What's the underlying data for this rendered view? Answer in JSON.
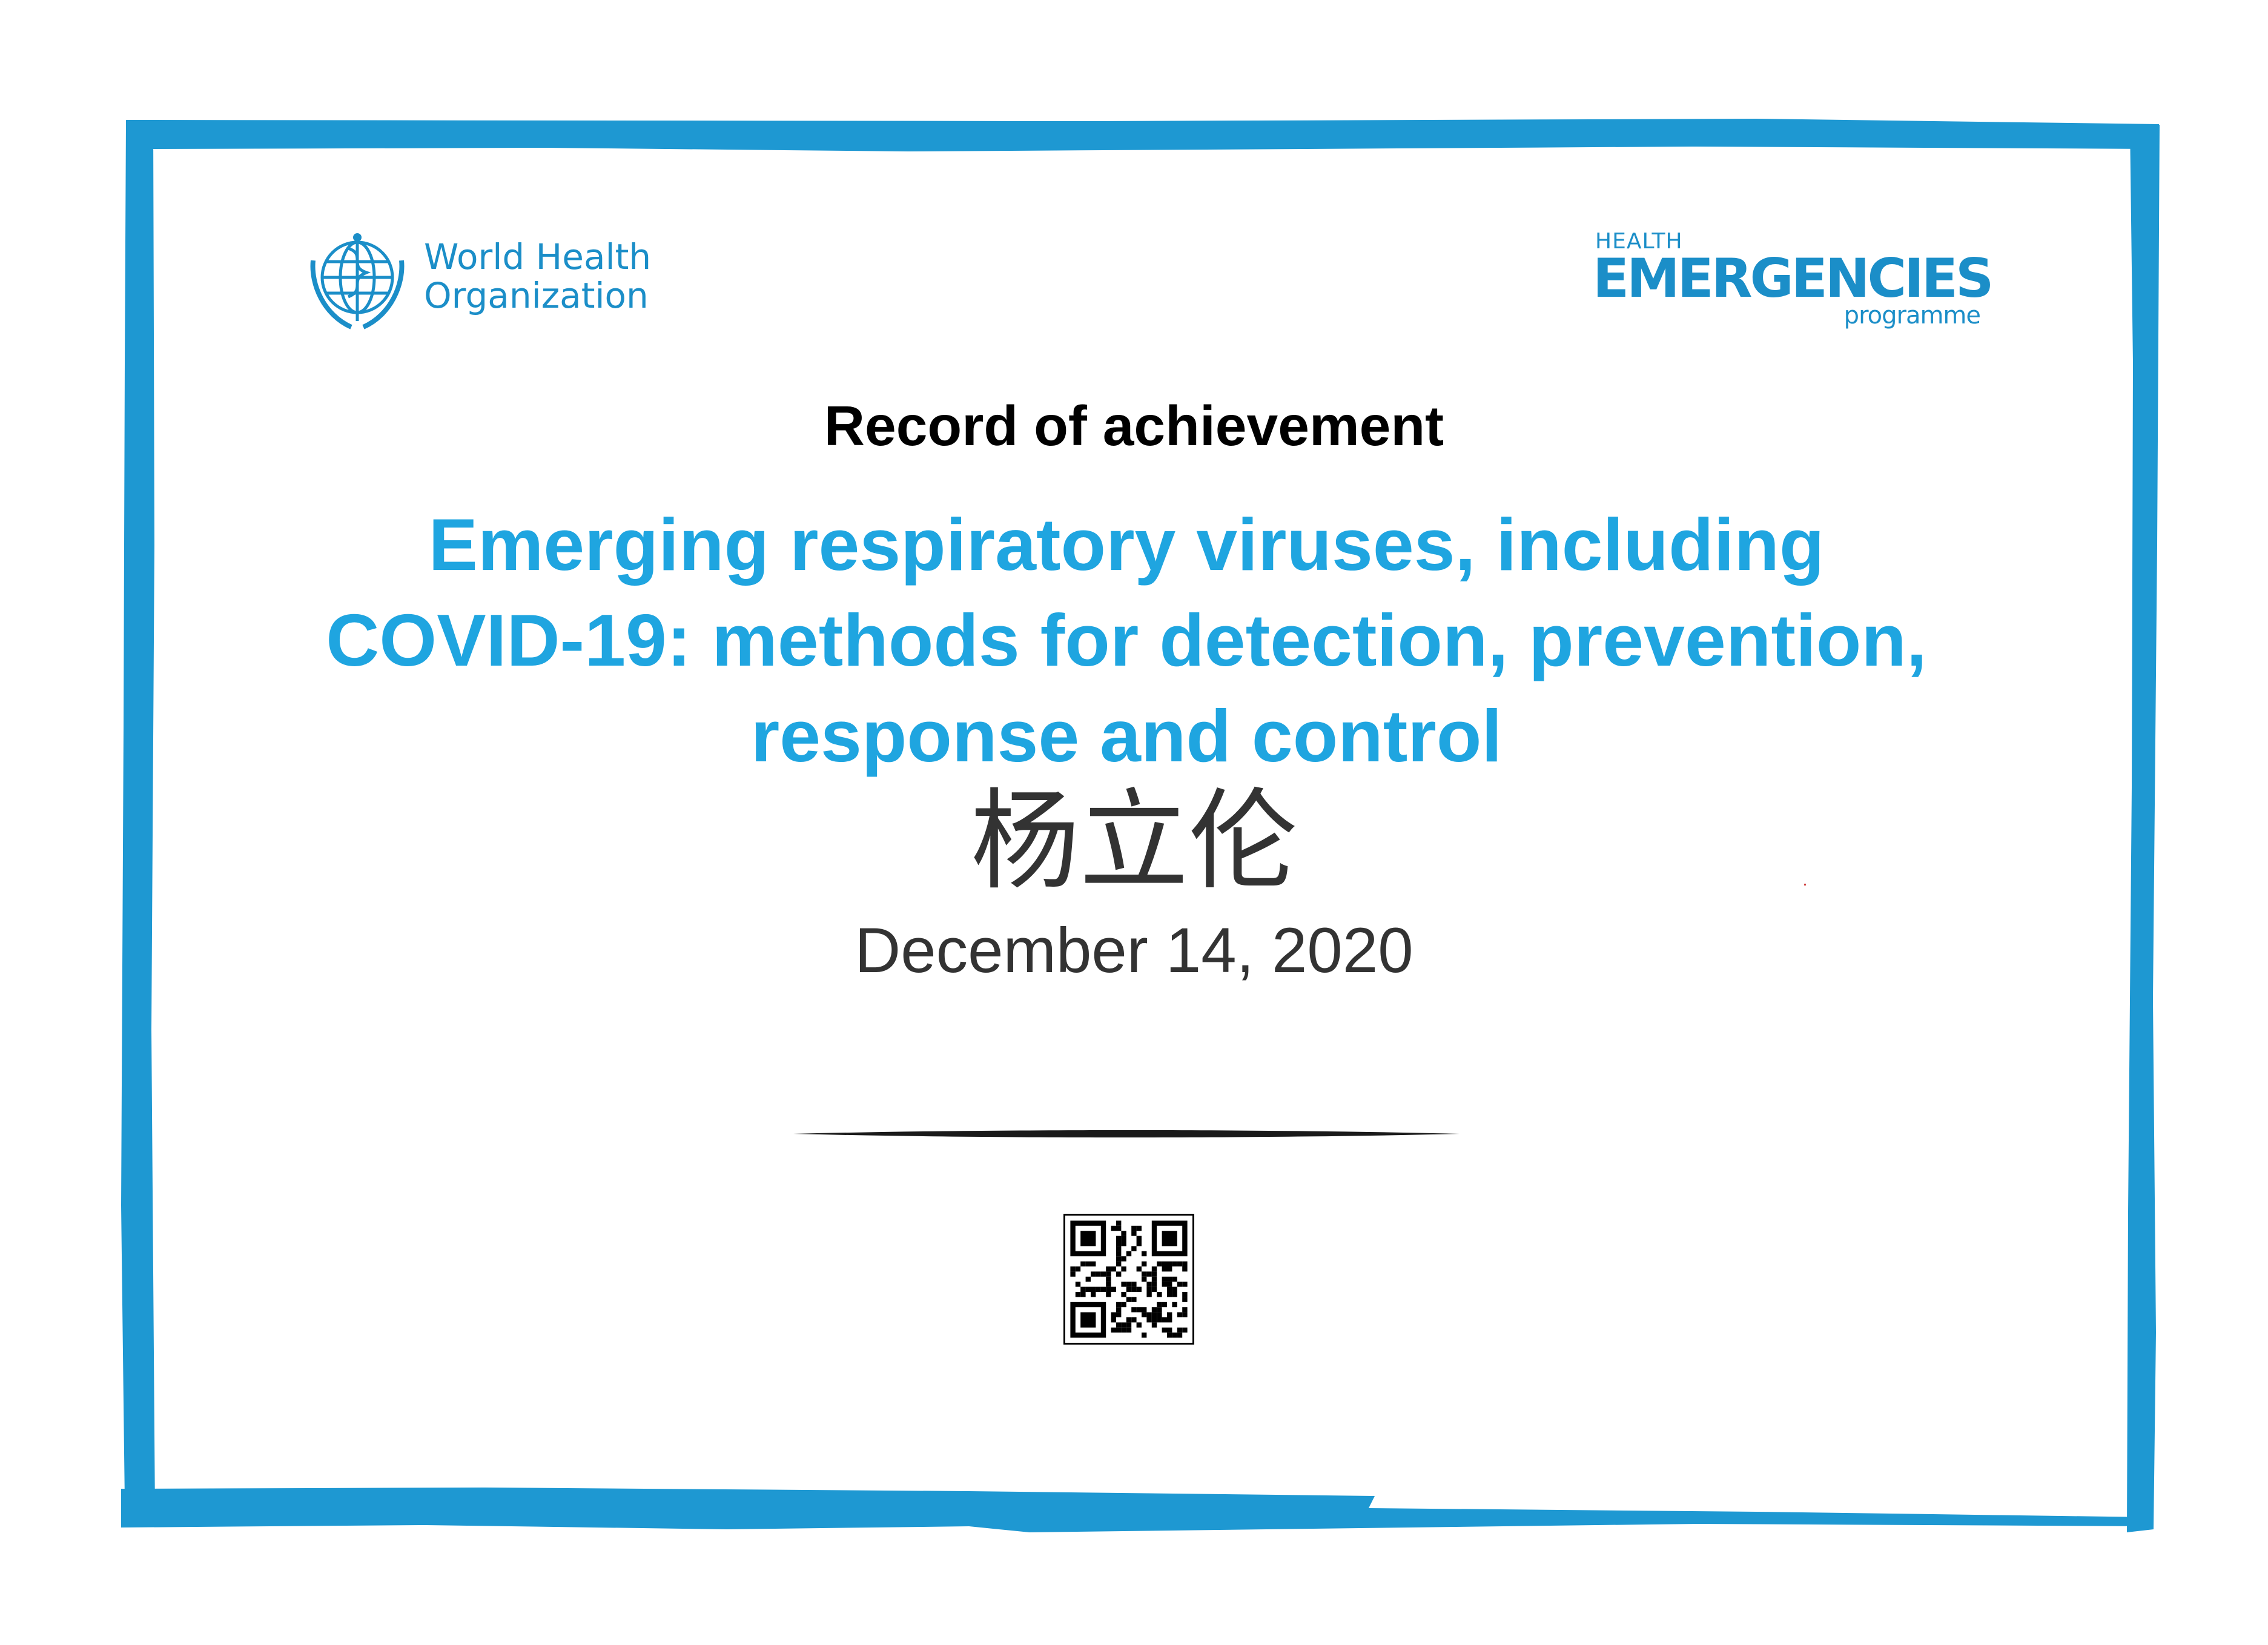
{
  "brand": {
    "border_color": "#1e98d2",
    "text_color": "#1b8ec8",
    "accent": "#1fa5e0"
  },
  "logos": {
    "left": {
      "icon": "who-emblem-icon",
      "line1": "World Health",
      "line2": "Organization"
    },
    "right": {
      "small": "HEALTH",
      "big": "EMERGENCIES",
      "sub": "programme"
    }
  },
  "certificate": {
    "heading": "Record of achievement",
    "course_lines": [
      "Emerging respiratory viruses, including",
      "COVID-19: methods for detection, prevention,",
      "response and control"
    ],
    "recipient": "杨立伦",
    "date": "December 14, 2020"
  },
  "qr": {
    "icon": "qr-code-icon"
  }
}
